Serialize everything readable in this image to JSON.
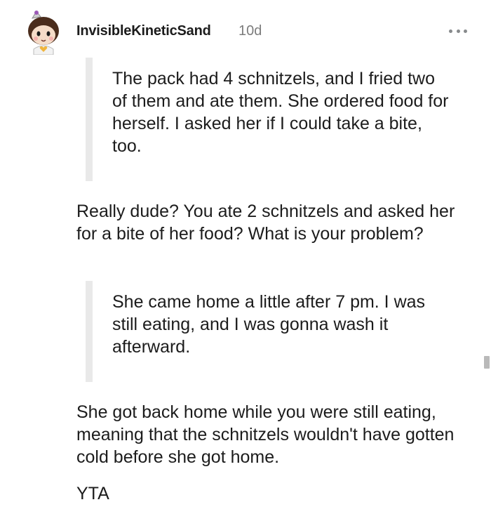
{
  "comment": {
    "author": "InvisibleKineticSand",
    "age": "10d",
    "avatar_icon": "snoo-avatar-icon",
    "more_icon": "more-options-icon",
    "quotes": [
      "The pack had 4 schnitzels, and I fried two of them and ate them. She ordered food for herself. I asked her if I could take a bite, too.",
      "She came home a little after 7 pm. I was still eating, and I was gonna wash it afterward."
    ],
    "paragraphs": [
      "Really dude? You ate 2 schnitzels and asked her for a bite of her food? What is your problem?",
      "She got back home while you were still eating, meaning that the schnitzels wouldn't have gotten cold before she got home.",
      "YTA"
    ]
  },
  "colors": {
    "text": "#1c1c1c",
    "meta": "#7c7c7c",
    "quote_bar": "#e9e9e9",
    "accent_avatar": "#e0a030"
  }
}
